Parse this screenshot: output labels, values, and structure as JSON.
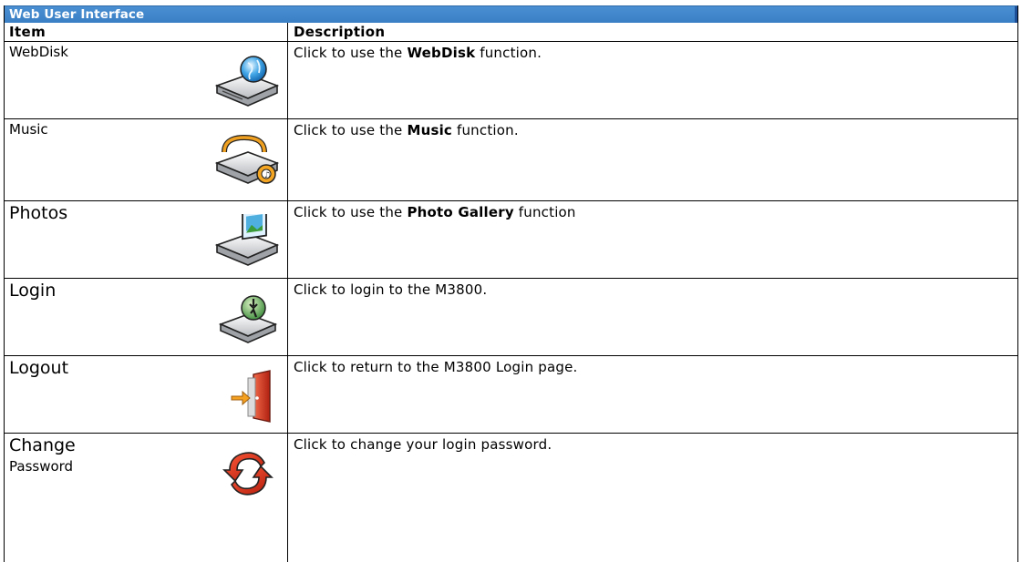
{
  "header": {
    "title": "Web User Interface"
  },
  "columns": {
    "item": "Item",
    "description": "Description"
  },
  "rows": [
    {
      "item": "WebDisk",
      "icon": "webdisk-globe-drive-icon",
      "desc_prefix": "Click to use the ",
      "desc_bold": "WebDisk",
      "desc_suffix": " function."
    },
    {
      "item": "Music",
      "icon": "music-drive-icon",
      "desc_prefix": "Click to use the ",
      "desc_bold": "Music",
      "desc_suffix": " function."
    },
    {
      "item": "Photos",
      "icon": "photo-gallery-drive-icon",
      "desc_prefix": "Click to use the ",
      "desc_bold": "Photo Gallery",
      "desc_suffix": " function"
    },
    {
      "item": "Login",
      "icon": "login-drive-icon",
      "desc_prefix": "Click to login to the M3800.",
      "desc_bold": "",
      "desc_suffix": ""
    },
    {
      "item": "Logout",
      "icon": "logout-door-icon",
      "desc_prefix": "Click to return to the M3800 Login page.",
      "desc_bold": "",
      "desc_suffix": ""
    },
    {
      "item_line1": "Change",
      "item_line2": "Password",
      "icon": "change-password-arrows-icon",
      "desc_prefix": "Click to change your login password.",
      "desc_bold": "",
      "desc_suffix": ""
    }
  ],
  "colors": {
    "title_bar": "#3d85c6",
    "title_text": "#ffffff"
  }
}
